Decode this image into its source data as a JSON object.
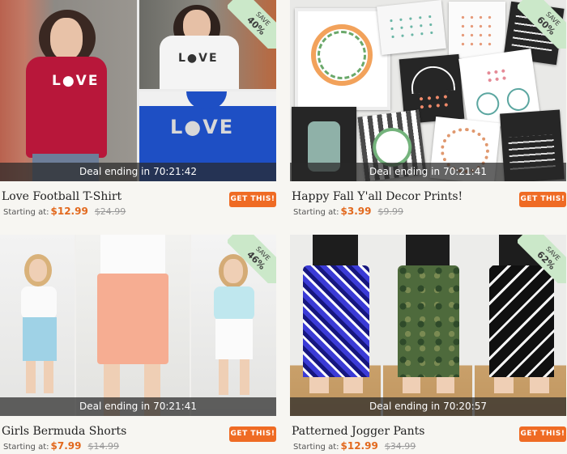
{
  "deal_prefix": "Deal ending in",
  "get_label": "GET THIS!",
  "starting_label": "Starting at:",
  "save_label": "SAVE",
  "colors": {
    "accent": "#ef6b24",
    "ribbon": "#cbe8c9",
    "strike": "#999999"
  },
  "products": [
    {
      "title": "Love Football T-Shirt",
      "price": "$12.99",
      "was": "$24.99",
      "timer": "70:21:42",
      "save": "40%",
      "tee_text": "L●VE"
    },
    {
      "title": "Happy Fall Y'all Decor Prints!",
      "price": "$3.99",
      "was": "$9.99",
      "timer": "70:21:41",
      "save": "60%"
    },
    {
      "title": "Girls Bermuda Shorts",
      "price": "$7.99",
      "was": "$14.99",
      "timer": "70:21:41",
      "save": "46%"
    },
    {
      "title": "Patterned Jogger Pants",
      "price": "$12.99",
      "was": "$34.99",
      "timer": "70:20:57",
      "save": "62%"
    }
  ]
}
